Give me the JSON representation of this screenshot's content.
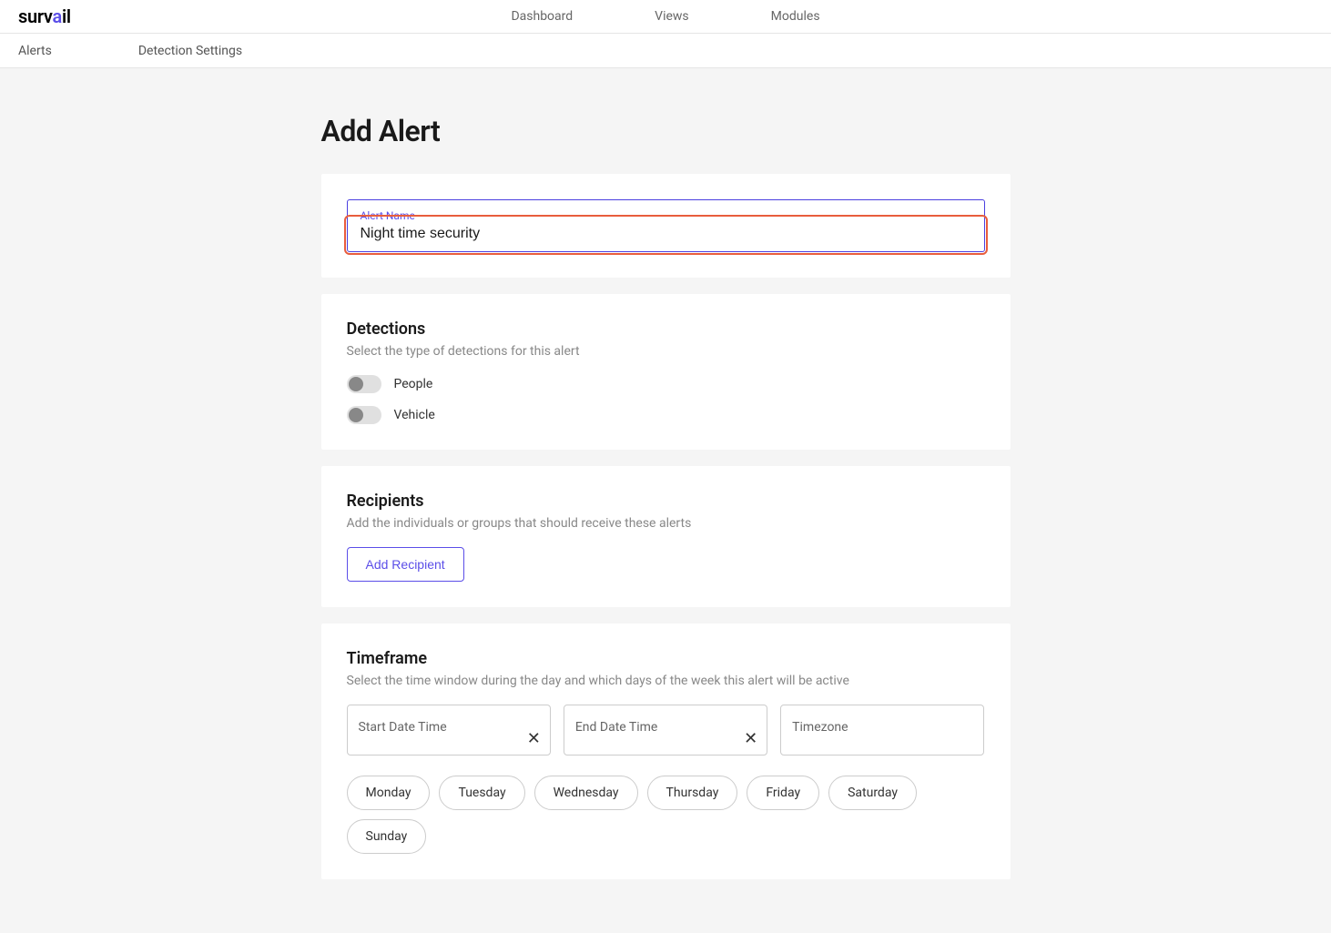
{
  "logo": {
    "pre": "surv",
    "accent": "a",
    "post": "il"
  },
  "topnav": {
    "items": [
      "Dashboard",
      "Views",
      "Modules"
    ]
  },
  "subnav": {
    "items": [
      "Alerts",
      "Detection Settings"
    ]
  },
  "page": {
    "title": "Add Alert"
  },
  "alertName": {
    "label": "Alert Name",
    "value": "Night time security"
  },
  "detections": {
    "title": "Detections",
    "desc": "Select the type of detections for this alert",
    "options": [
      {
        "label": "People",
        "on": false
      },
      {
        "label": "Vehicle",
        "on": false
      }
    ]
  },
  "recipients": {
    "title": "Recipients",
    "desc": "Add the individuals or groups that should receive these alerts",
    "addBtn": "Add Recipient"
  },
  "timeframe": {
    "title": "Timeframe",
    "desc": "Select the time window during the day and which days of the week this alert will be active",
    "start": {
      "label": "Start Date Time"
    },
    "end": {
      "label": "End Date Time"
    },
    "tz": {
      "label": "Timezone"
    },
    "days": [
      "Monday",
      "Tuesday",
      "Wednesday",
      "Thursday",
      "Friday",
      "Saturday",
      "Sunday"
    ]
  }
}
